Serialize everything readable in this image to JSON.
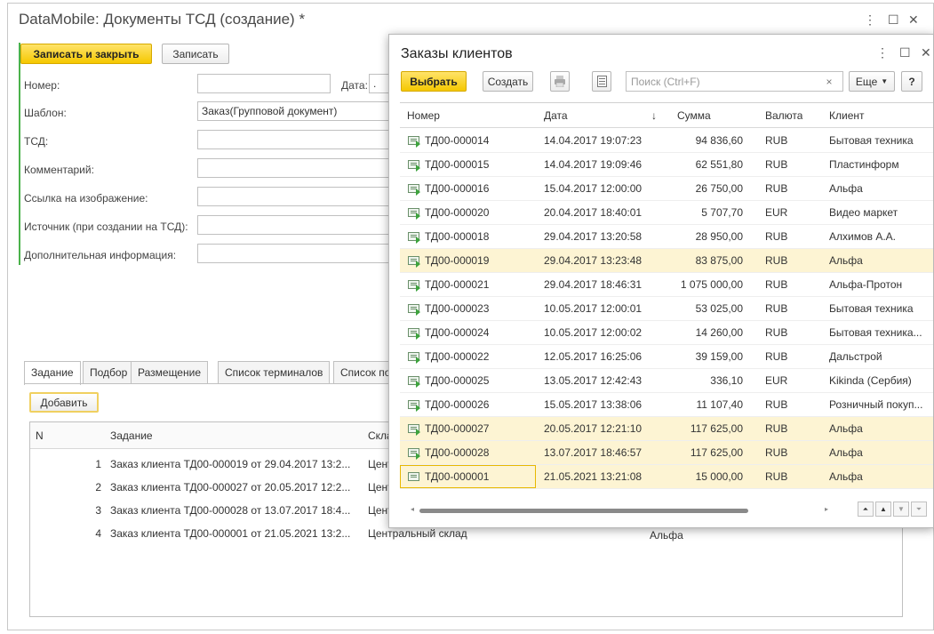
{
  "main": {
    "title": "DataMobile: Документы ТСД (создание) *",
    "toolbar": {
      "save_close": "Записать и закрыть",
      "save": "Записать"
    },
    "fields": {
      "number_label": "Номер:",
      "date_label": "Дата:",
      "date_value": ".",
      "template_label": "Шаблон:",
      "template_value": "Заказ(Групповой документ)",
      "tsd_label": "ТСД:",
      "comment_label": "Комментарий:",
      "image_link_label": "Ссылка на изображение:",
      "source_label": "Источник (при создании на ТСД):",
      "extra_label": "Дополнительная информация:"
    },
    "tabs": [
      "Задание",
      "Подбор",
      "Размещение",
      "Список терминалов",
      "Список по"
    ],
    "add_button": "Добавить",
    "task_table": {
      "col_n": "N",
      "col_task": "Задание",
      "col_store": "Скла",
      "rows": [
        {
          "n": "1",
          "task": "Заказ клиента ТД00-000019 от 29.04.2017 13:2...",
          "store": "Цент",
          "client": ""
        },
        {
          "n": "2",
          "task": "Заказ клиента ТД00-000027 от 20.05.2017 12:2...",
          "store": "Цент",
          "client": ""
        },
        {
          "n": "3",
          "task": "Заказ клиента ТД00-000028 от 13.07.2017 18:4...",
          "store": "Цент",
          "client": ""
        },
        {
          "n": "4",
          "task": "Заказ клиента ТД00-000001 от 21.05.2021 13:2...",
          "store": "Центральный склад",
          "client": "Альфа"
        }
      ]
    }
  },
  "popup": {
    "title": "Заказы клиентов",
    "toolbar": {
      "select": "Выбрать",
      "create": "Создать",
      "more": "Еще",
      "help": "?"
    },
    "search_placeholder": "Поиск (Ctrl+F)",
    "columns": {
      "number": "Номер",
      "date": "Дата",
      "sort_arrow": "↓",
      "sum": "Сумма",
      "currency": "Валюта",
      "client": "Клиент"
    },
    "rows": [
      {
        "number": "ТД00-000014",
        "date": "14.04.2017 19:07:23",
        "sum": "94 836,60",
        "currency": "RUB",
        "client": "Бытовая техника",
        "selected": false
      },
      {
        "number": "ТД00-000015",
        "date": "14.04.2017 19:09:46",
        "sum": "62 551,80",
        "currency": "RUB",
        "client": "Пластинформ",
        "selected": false
      },
      {
        "number": "ТД00-000016",
        "date": "15.04.2017 12:00:00",
        "sum": "26 750,00",
        "currency": "RUB",
        "client": "Альфа",
        "selected": false
      },
      {
        "number": "ТД00-000020",
        "date": "20.04.2017 18:40:01",
        "sum": "5 707,70",
        "currency": "EUR",
        "client": "Видео маркет",
        "selected": false
      },
      {
        "number": "ТД00-000018",
        "date": "29.04.2017 13:20:58",
        "sum": "28 950,00",
        "currency": "RUB",
        "client": "Алхимов А.А.",
        "selected": false
      },
      {
        "number": "ТД00-000019",
        "date": "29.04.2017 13:23:48",
        "sum": "83 875,00",
        "currency": "RUB",
        "client": "Альфа",
        "selected": true
      },
      {
        "number": "ТД00-000021",
        "date": "29.04.2017 18:46:31",
        "sum": "1 075 000,00",
        "currency": "RUB",
        "client": "Альфа-Протон",
        "selected": false
      },
      {
        "number": "ТД00-000023",
        "date": "10.05.2017 12:00:01",
        "sum": "53 025,00",
        "currency": "RUB",
        "client": "Бытовая техника",
        "selected": false
      },
      {
        "number": "ТД00-000024",
        "date": "10.05.2017 12:00:02",
        "sum": "14 260,00",
        "currency": "RUB",
        "client": "Бытовая техника...",
        "selected": false
      },
      {
        "number": "ТД00-000022",
        "date": "12.05.2017 16:25:06",
        "sum": "39 159,00",
        "currency": "RUB",
        "client": "Дальстрой",
        "selected": false
      },
      {
        "number": "ТД00-000025",
        "date": "13.05.2017 12:42:43",
        "sum": "336,10",
        "currency": "EUR",
        "client": "Kikinda (Сербия)",
        "selected": false
      },
      {
        "number": "ТД00-000026",
        "date": "15.05.2017 13:38:06",
        "sum": "11 107,40",
        "currency": "RUB",
        "client": "Розничный покуп...",
        "selected": false
      },
      {
        "number": "ТД00-000027",
        "date": "20.05.2017 12:21:10",
        "sum": "117 625,00",
        "currency": "RUB",
        "client": "Альфа",
        "selected": true
      },
      {
        "number": "ТД00-000028",
        "date": "13.07.2017 18:46:57",
        "sum": "117 625,00",
        "currency": "RUB",
        "client": "Альфа",
        "selected": true
      },
      {
        "number": "ТД00-000001",
        "date": "21.05.2021 13:21:08",
        "sum": "15 000,00",
        "currency": "RUB",
        "client": "Альфа",
        "selected": true
      }
    ]
  },
  "icons": {
    "window_menu": "more-vert-icon",
    "maximize": "maximize-icon",
    "close": "close-icon",
    "print": "print-icon",
    "list": "list-icon",
    "clear": "clear-icon"
  },
  "colors": {
    "accent_yellow": "#f5c800",
    "selected_row": "#fdf4d3",
    "status_green": "#4bb24b"
  }
}
